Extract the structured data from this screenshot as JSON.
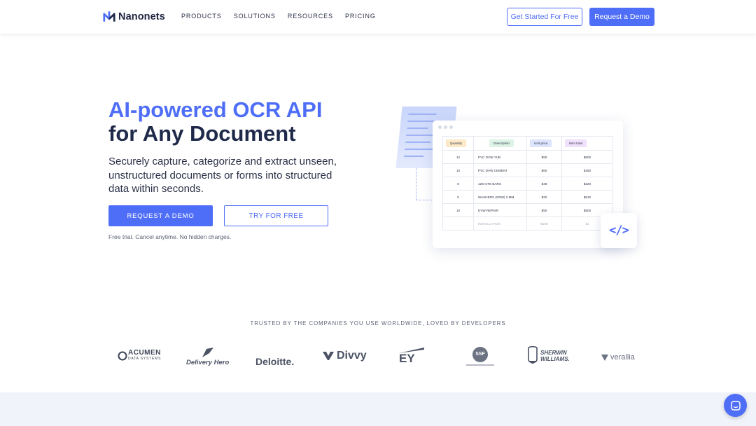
{
  "nav": {
    "brand": "Nanonets",
    "menu": [
      "PRODUCTS",
      "SOLUTIONS",
      "RESOURCES",
      "PRICING"
    ],
    "get_started_label": "Get Started For Free",
    "request_demo_label": "Request a Demo"
  },
  "hero": {
    "title_line1": "AI-powered OCR API",
    "title_line2": "for Any Document",
    "subtitle": "Securely capture, categorize and extract unseen, unstructured documents or forms into structured data within seconds.",
    "cta_primary": "REQUEST A DEMO",
    "cta_secondary": "TRY FOR FREE",
    "note": "Free trial. Cancel anytime. No hidden charges."
  },
  "illustration": {
    "table_headers": [
      "Quantity",
      "Description",
      "Unit price",
      "Item total"
    ],
    "rows": [
      [
        "12",
        "PVC DVW YUB",
        "$50",
        "$600"
      ],
      [
        "10",
        "PVC DVW CEMENT",
        "$60",
        "$250"
      ],
      [
        "8",
        "12M STE BARS",
        "$48",
        "$320"
      ],
      [
        "5",
        "WASHERS (GRW) 3 MM",
        "$32",
        "$610"
      ],
      [
        "10",
        "DVW REPAIR",
        "$50",
        "$500"
      ],
      [
        "",
        "INSTALLATION",
        "$100",
        "$1"
      ]
    ],
    "code_glyph": "</>",
    "header_colors": [
      "#fde9c8",
      "#dcf3e6",
      "#dde5fd",
      "#efe0fb"
    ]
  },
  "trusted": {
    "heading": "TRUSTED BY THE COMPANIES YOU USE WORLDWIDE, LOVED BY DEVELOPERS",
    "logos": [
      {
        "name": "ACUMEN",
        "sub": "DATA SYSTEMS"
      },
      {
        "name": "Delivery Hero"
      },
      {
        "name": "Deloitte."
      },
      {
        "name": "Divvy"
      },
      {
        "name": "EY"
      },
      {
        "name": "SSF"
      },
      {
        "name": "SHERWIN WILLIAMS."
      },
      {
        "name": "verallia"
      }
    ]
  },
  "colors": {
    "accent": "#4f6ef7",
    "dark": "#1f2a4a"
  }
}
